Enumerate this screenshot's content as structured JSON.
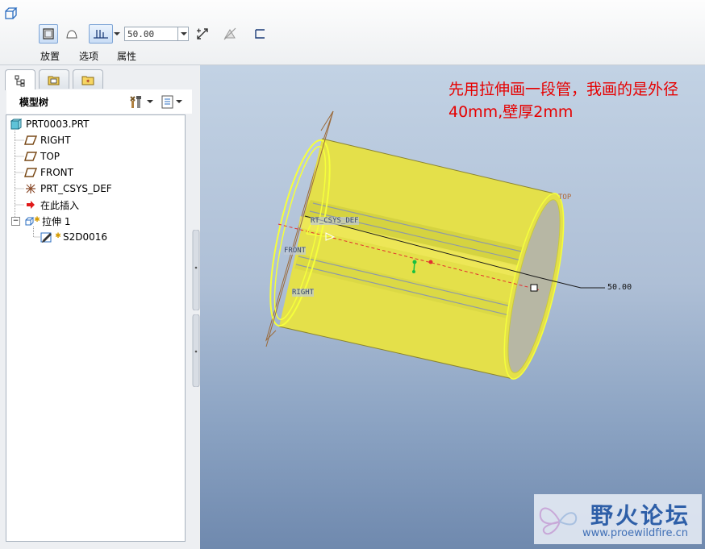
{
  "dashboard": {
    "tabs": [
      {
        "label": "放置"
      },
      {
        "label": "选项"
      },
      {
        "label": "属性"
      }
    ],
    "depth_value": "50.00"
  },
  "model_tree": {
    "title": "模型树",
    "nodes": [
      {
        "label": "PRT0003.PRT"
      },
      {
        "label": "RIGHT"
      },
      {
        "label": "TOP"
      },
      {
        "label": "FRONT"
      },
      {
        "label": "PRT_CSYS_DEF"
      },
      {
        "label": "在此插入"
      },
      {
        "label": "拉伸 1"
      },
      {
        "label": "S2D0016"
      }
    ]
  },
  "viewport": {
    "annotation": "先用拉伸画一段管，我画的是外径40mm,壁厚2mm",
    "labels": {
      "top": "TOP",
      "csys": "RT_CSYS_DEF",
      "front": "FRONT",
      "right": "RIGHT",
      "dimension": "50.00"
    }
  },
  "watermark": {
    "title": "野火论坛",
    "url": "www.proewildfire.cn"
  },
  "colors": {
    "annotation": "#e60000",
    "tube": "#e6e24a",
    "edge_highlight": "#f5ff3c",
    "watermark": "#2e5fa8"
  }
}
